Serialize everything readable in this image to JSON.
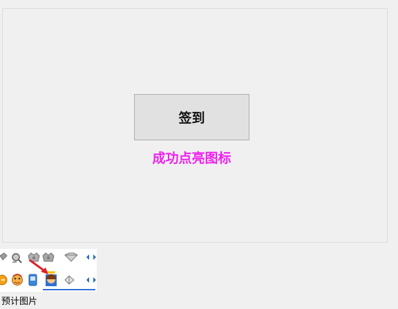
{
  "window": {
    "background": "#f0f0f0"
  },
  "main": {
    "signin_label": "签到",
    "status_text": "成功点亮图标",
    "status_color": "#ee22ee"
  },
  "preview": {
    "caption": "预计图片",
    "row1_icons": [
      "gray-diamond-icon",
      "gray-magnifier-icon",
      "gray-crown-icon",
      "gray-crown-icon",
      "gray-diamond-icon",
      "arrow-left-right-icon"
    ],
    "row2_icons": [
      "orange-smiley-icon",
      "orange-face-icon",
      "blue-phone-icon",
      "lit-avatar-icon",
      "gray-diamond-icon",
      "arrow-left-right-icon"
    ],
    "arrow_color": "#e0202a",
    "highlight_color": "#2d6fd6"
  }
}
